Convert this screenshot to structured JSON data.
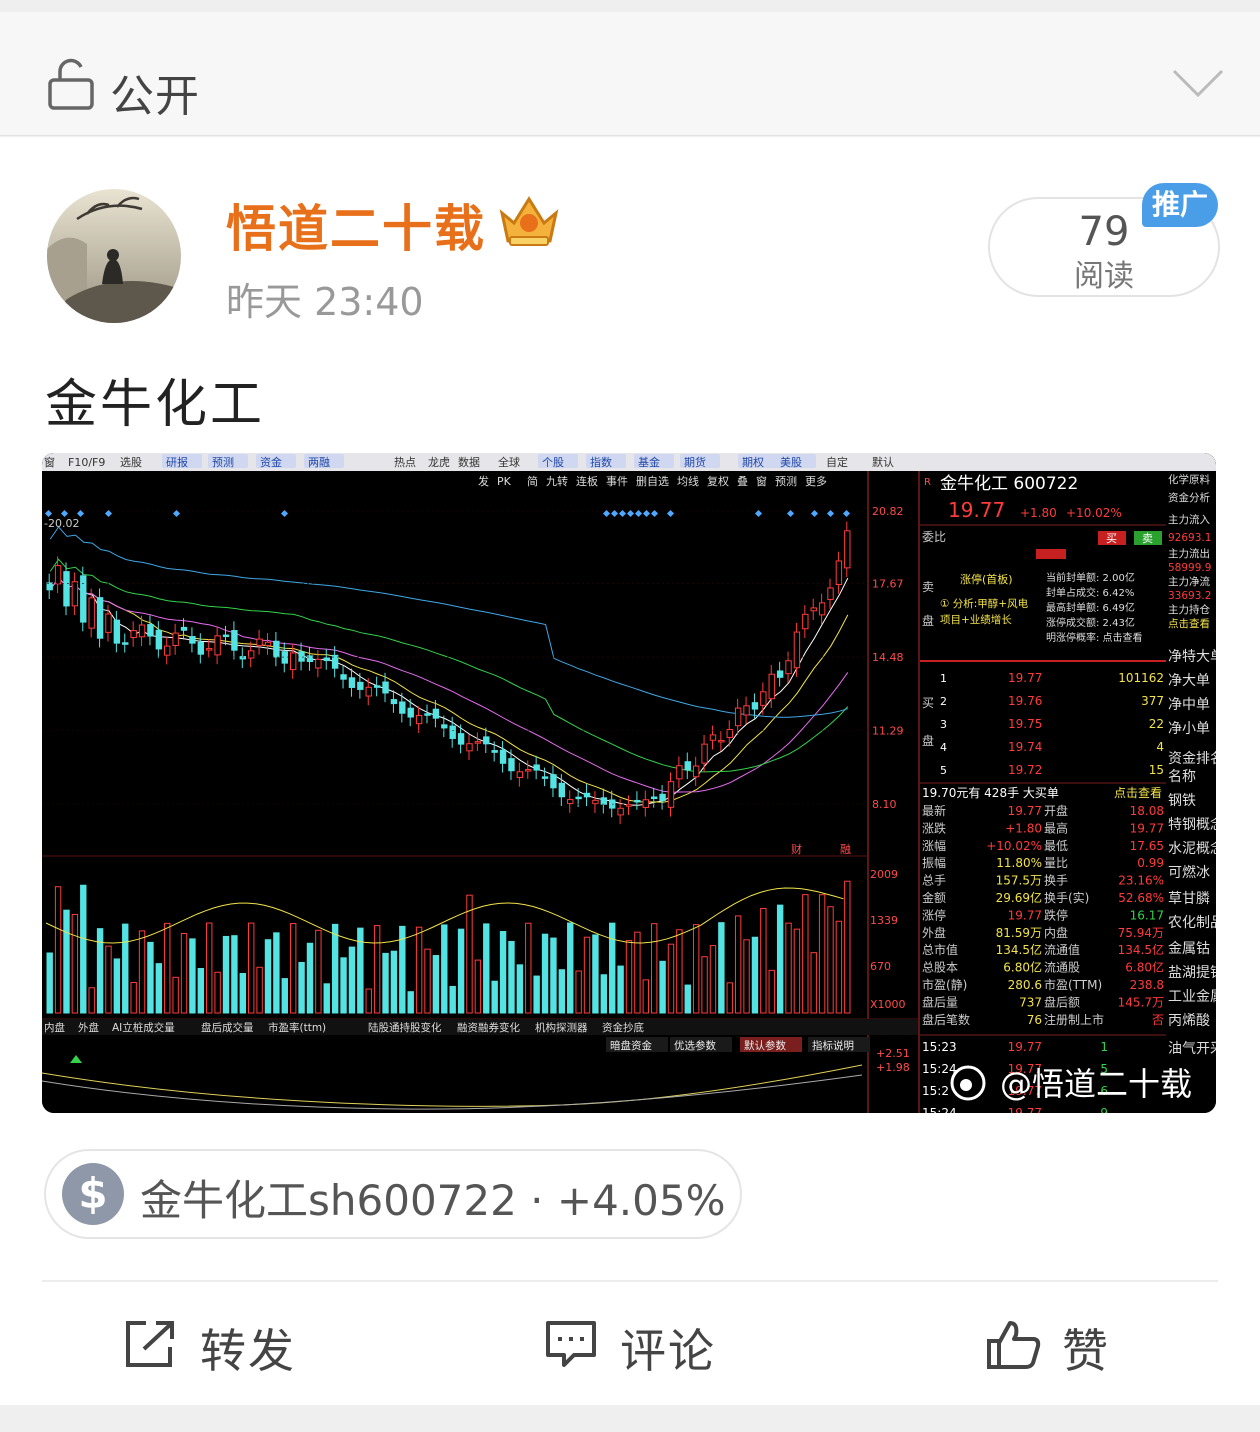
{
  "privacy": {
    "label": "公开"
  },
  "post": {
    "username": "悟道二十载",
    "time": "昨天 23:40",
    "read_count": "79",
    "read_label": "阅读",
    "promo_badge": "推广",
    "title": "金牛化工",
    "stock_tag": {
      "symbol_icon": "$",
      "text": "金牛化工sh600722 · +4.05%"
    }
  },
  "screenshot": {
    "menu": [
      "窗",
      "F10/F9",
      "选股",
      "研报",
      "预测",
      "资金",
      "两融",
      "热点",
      "龙虎",
      "数据",
      "全球",
      "个股",
      "指数",
      "基金",
      "期货",
      "期权",
      "美股",
      "自定",
      "默认"
    ],
    "toolbar": [
      "发",
      "PK",
      "简",
      "九转",
      "连板",
      "事件",
      "删自选",
      "均线",
      "复权",
      "叠",
      "窗",
      "预测",
      "更多"
    ],
    "price_high_label": "20.02",
    "price_ticks": [
      "20.82",
      "17.67",
      "14.48",
      "11.29",
      "8.10"
    ],
    "vol_ticks": [
      "2009",
      "1339",
      "670",
      "X1000"
    ],
    "ind_ticks": [
      "+2.51",
      "+1.98"
    ],
    "markers": [
      "财",
      "融"
    ],
    "bottom_tabs": [
      "内盘",
      "外盘",
      "AI立桩成交量",
      "盘后成交量",
      "市盈率(ttm)",
      "陆股通持股变化",
      "融资融券变化",
      "机构探测器",
      "资金抄底"
    ],
    "sub_tabs": [
      "暗盘资金",
      "优选参数",
      "默认参数",
      "指标说明"
    ],
    "quote": {
      "name": "金牛化工 600722",
      "price": "19.77",
      "change": "+1.80",
      "pct": "+10.02%",
      "weibi": "委比",
      "buy": "买",
      "sell": "卖",
      "limit_title": "涨停(首板)",
      "analysis": "分析:甲醇+风电",
      "project": "项目+业绩增长",
      "seal_info": [
        "当前封单额: 2.00亿",
        "封单占成交: 6.42%",
        "最高封单额: 6.49亿",
        "涨停成交额: 2.43亿",
        "明涨停概率: 点击查看"
      ],
      "sell_side": "卖盘",
      "buy_side": "买盘",
      "bids": [
        {
          "lvl": "1",
          "price": "19.77",
          "vol": "101162"
        },
        {
          "lvl": "2",
          "price": "19.76",
          "vol": "377"
        },
        {
          "lvl": "3",
          "price": "19.75",
          "vol": "22"
        },
        {
          "lvl": "4",
          "price": "19.74",
          "vol": "4"
        },
        {
          "lvl": "5",
          "price": "19.72",
          "vol": "15"
        }
      ],
      "bigbuy": "19.70元有 428手 大买单",
      "bigbuy_link": "点击查看",
      "stats": [
        [
          "最新",
          "19.77",
          "开盘",
          "18.08"
        ],
        [
          "涨跌",
          "+1.80",
          "最高",
          "19.77"
        ],
        [
          "涨幅",
          "+10.02%",
          "最低",
          "17.65"
        ],
        [
          "振幅",
          "11.80%",
          "量比",
          "0.99"
        ],
        [
          "总手",
          "157.5万",
          "换手",
          "23.16%"
        ],
        [
          "金额",
          "29.69亿",
          "换手(实)",
          "52.68%"
        ],
        [
          "涨停",
          "19.77",
          "跌停",
          "16.17"
        ],
        [
          "外盘",
          "81.59万",
          "内盘",
          "75.94万"
        ],
        [
          "总市值",
          "134.5亿",
          "流通值",
          "134.5亿"
        ],
        [
          "总股本",
          "6.80亿",
          "流通股",
          "6.80亿"
        ],
        [
          "市盈(静)",
          "280.6",
          "市盈(TTM)",
          "238.8"
        ],
        [
          "盘后量",
          "737",
          "盘后额",
          "145.7万"
        ],
        [
          "盘后笔数",
          "76",
          "注册制上市",
          "否"
        ]
      ],
      "ticks": [
        {
          "t": "15:23",
          "p": "19.77",
          "v": "1"
        },
        {
          "t": "15:24",
          "p": "19.77",
          "v": "5"
        },
        {
          "t": "15:2",
          "p": "19.77",
          "v": "6"
        },
        {
          "t": "15:24",
          "p": "19.77",
          "v": "9"
        }
      ]
    },
    "side": [
      "化学原料",
      "资金分析",
      "主力流入",
      "92693.1",
      "主力流出",
      "58999.9",
      "主力净流",
      "33693.2",
      "主力持仓",
      "点击查看",
      "净特大单",
      "净大单",
      "净中单",
      "净小单",
      "资金排名",
      "名称",
      "钢铁",
      "特钢概念",
      "水泥概念",
      "可燃冰",
      "草甘膦",
      "农化制品",
      "金属钴",
      "盐湖提锂",
      "工业金属",
      "丙烯酸",
      "油气开采"
    ],
    "watermark": "@悟道二十载"
  },
  "actions": {
    "repost": "转发",
    "comment": "评论",
    "like": "赞"
  },
  "colors": {
    "brand_orange": "#e8701a",
    "promo_blue": "#4a9ee8",
    "chart_up": "#ff3b3b",
    "chart_down": "#54e3e3"
  }
}
